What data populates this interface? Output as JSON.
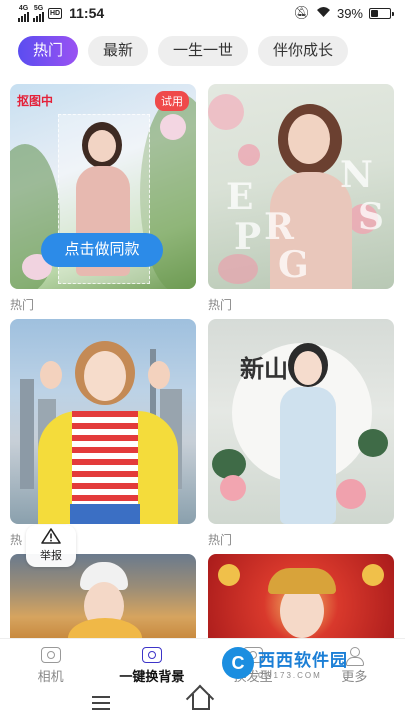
{
  "status_bar": {
    "net1": "4G",
    "net2": "5G",
    "hd": "HD",
    "time": "11:54",
    "battery_percent": "39%",
    "battery_level": 0.39
  },
  "tabs": [
    {
      "label": "热门",
      "active": true
    },
    {
      "label": "最新",
      "active": false
    },
    {
      "label": "一生一世",
      "active": false
    },
    {
      "label": "伴你成长",
      "active": false
    }
  ],
  "cards": [
    {
      "label": "热门",
      "badge": "抠图中",
      "trial": "试用",
      "button": "点击做同款"
    },
    {
      "label": "热门",
      "overlay_text": [
        "E",
        "N",
        "S",
        "P",
        "R",
        "G"
      ]
    },
    {
      "label": "热",
      "report": "举报"
    },
    {
      "label": "热门",
      "overlay_chars": "新山"
    },
    {
      "label": ""
    },
    {
      "label": ""
    }
  ],
  "bottom_nav": [
    {
      "label": "相机",
      "active": false
    },
    {
      "label": "一键换背景",
      "active": true
    },
    {
      "label": "换发型",
      "active": false
    },
    {
      "label": "更多",
      "active": false
    }
  ],
  "watermark": {
    "main": "西西软件园",
    "sub": "CR173.COM",
    "logo": "C"
  }
}
